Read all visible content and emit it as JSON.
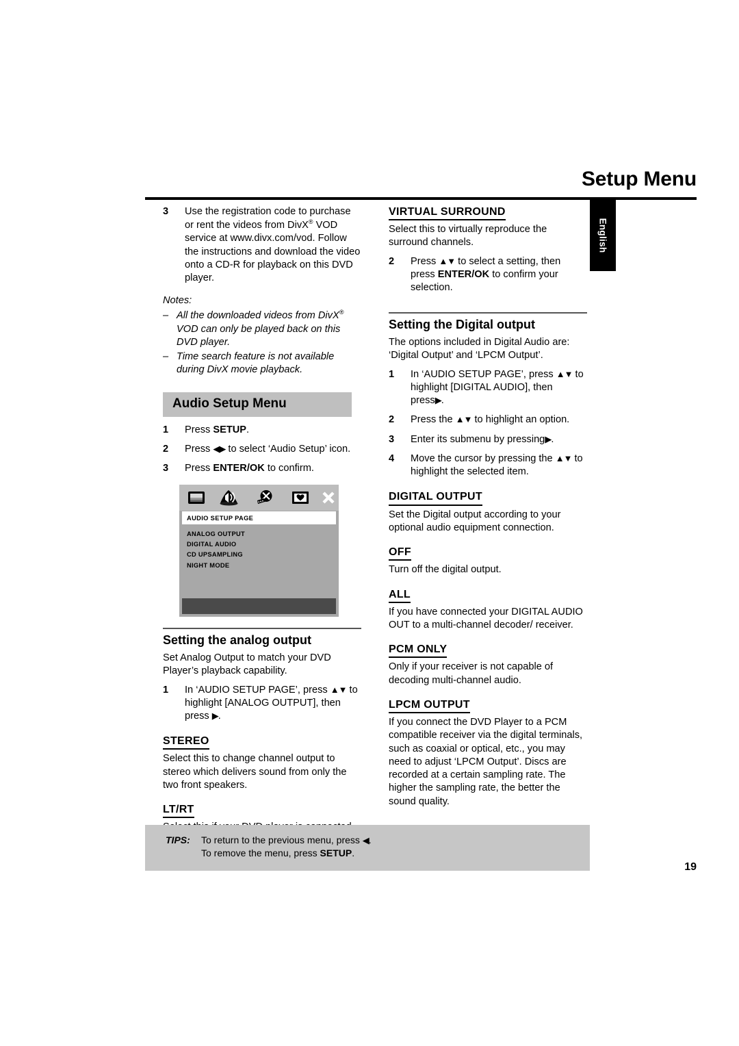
{
  "header": {
    "title": "Setup Menu",
    "language_tab": "English"
  },
  "left_column": {
    "step3": {
      "num": "3",
      "text": "Use the registration code to purchase or rent the videos from DivX® VOD service at www.divx.com/vod. Follow the instructions and download the video onto a CD-R for playback on this DVD player."
    },
    "notes_label": "Notes:",
    "notes": [
      "All the downloaded videos from DivX® VOD can only be played back on this DVD player.",
      "Time search feature is not available during DivX movie playback."
    ],
    "section_title": "Audio Setup Menu",
    "steps": [
      {
        "num": "1",
        "text": "Press SETUP."
      },
      {
        "num": "2",
        "text": "Press ◀▶ to select ‘Audio Setup’ icon."
      },
      {
        "num": "3",
        "text": "Press ENTER/OK to confirm."
      }
    ],
    "osd": {
      "icons": [
        "tv-screen-icon",
        "audio-speaker-icon",
        "film-reel-icon",
        "preference-icon",
        "close-x-icon"
      ],
      "title": "AUDIO SETUP PAGE",
      "items": [
        "ANALOG OUTPUT",
        "DIGITAL AUDIO",
        "CD UPSAMPLING",
        "NIGHT MODE"
      ]
    },
    "analog": {
      "heading": "Setting the analog output",
      "intro": "Set Analog Output to match your DVD Player’s playback capability.",
      "step1_num": "1",
      "step1_text": "In ‘AUDIO SETUP PAGE’, press ▲▼ to highlight [ANALOG OUTPUT], then press ▶.",
      "terms": [
        {
          "term": "STEREO",
          "desc": "Select this to change channel output to stereo which delivers sound from only the two front speakers."
        },
        {
          "term": "LT/RT",
          "desc": "Select this if your DVD player is connected to a Dolby Prologic decoder."
        }
      ]
    }
  },
  "right_column": {
    "virtual_surround": {
      "term": "VIRTUAL SURROUND",
      "desc": "Select this to virtually reproduce the surround channels.",
      "step2_num": "2",
      "step2_text": "Press ▲▼ to select a setting, then press ENTER/OK to confirm your selection."
    },
    "digital": {
      "heading": "Setting the Digital output",
      "intro": "The options included in Digital Audio are: ‘Digital Output’ and ‘LPCM Output’.",
      "steps": [
        {
          "num": "1",
          "text": "In ‘AUDIO SETUP PAGE’, press ▲▼ to highlight [DIGITAL AUDIO], then press ▶."
        },
        {
          "num": "2",
          "text": "Press the ▲▼ to highlight an option."
        },
        {
          "num": "3",
          "text": "Enter its submenu by pressing ▶."
        },
        {
          "num": "4",
          "text": "Move the cursor by pressing the ▲▼ to highlight the selected item."
        }
      ],
      "terms": [
        {
          "term": "DIGITAL OUTPUT",
          "desc": "Set the Digital output according to your optional audio equipment connection."
        },
        {
          "term": "OFF",
          "desc": "Turn off the digital output."
        },
        {
          "term": "ALL",
          "desc": "If you have connected your DIGITAL AUDIO OUT to a multi-channel decoder/ receiver."
        },
        {
          "term": "PCM ONLY",
          "desc": "Only if your receiver is not capable of decoding multi-channel audio."
        },
        {
          "term": "LPCM OUTPUT",
          "desc": "If you connect the DVD Player to a PCM compatible receiver via the digital terminals, such as coaxial or optical, etc., you may need to adjust ‘LPCM Output’. Discs are recorded at a certain sampling rate. The higher the sampling rate, the better the sound quality."
        }
      ]
    }
  },
  "tips": {
    "label": "TIPS:",
    "line1": "To return to the previous menu, press ◀.",
    "line2": "To remove the menu, press SETUP."
  },
  "page_number": "19"
}
